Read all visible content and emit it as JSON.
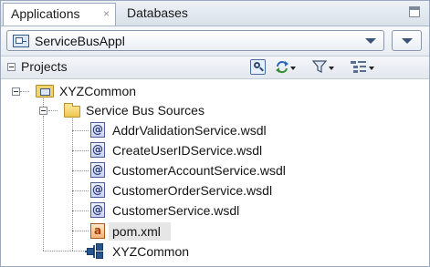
{
  "tabs": [
    {
      "label": "Applications",
      "active": true,
      "close": "×"
    },
    {
      "label": "Databases",
      "active": false
    }
  ],
  "application_selector": {
    "value": "ServiceBusAppl",
    "icon": "application-icon"
  },
  "projects_panel": {
    "title": "Projects",
    "toolbar_icons": [
      "find-icon",
      "sync-icon",
      "filter-icon",
      "navigator-options-icon"
    ]
  },
  "tree": {
    "root": {
      "label": "XYZCommon",
      "icon": "project-folder-icon",
      "expanded": true
    },
    "folder": {
      "label": "Service Bus Sources",
      "icon": "folder-icon",
      "expanded": true
    },
    "files": [
      {
        "label": "AddrValidationService.wsdl",
        "icon": "wsdl-icon",
        "glyph": "@"
      },
      {
        "label": "CreateUserIDService.wsdl",
        "icon": "wsdl-icon",
        "glyph": "@"
      },
      {
        "label": "CustomerAccountService.wsdl",
        "icon": "wsdl-icon",
        "glyph": "@"
      },
      {
        "label": "CustomerOrderService.wsdl",
        "icon": "wsdl-icon",
        "glyph": "@"
      },
      {
        "label": "CustomerService.wsdl",
        "icon": "wsdl-icon",
        "glyph": "@"
      },
      {
        "label": "pom.xml",
        "icon": "pom-xml-icon",
        "glyph": "a",
        "selected": true
      }
    ],
    "project_node": {
      "label": "XYZCommon",
      "icon": "project-structure-icon"
    }
  },
  "colors": {
    "selection": "#e6e6e6",
    "border": "#9aa9bd",
    "header_gradient_top": "#edf1f6"
  }
}
